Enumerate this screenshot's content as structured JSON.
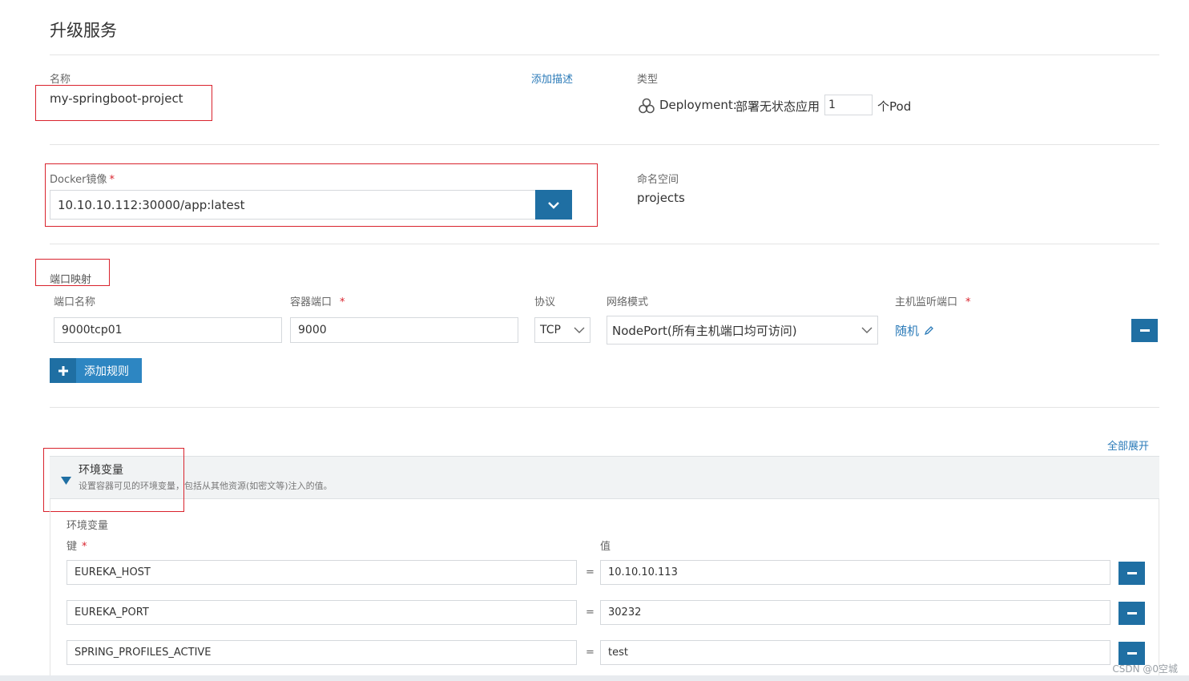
{
  "page": {
    "title": "升级服务"
  },
  "basic": {
    "name_label": "名称",
    "name_value": "my-springboot-project",
    "add_description": "添加描述",
    "type_label": "类型",
    "type_prefix": "Deployment:",
    "type_desc": "部署无状态应用",
    "pod_count": "1",
    "pod_suffix": "个Pod"
  },
  "image": {
    "label": "Docker镜像",
    "required": "*",
    "value": "10.10.10.112:30000/app:latest",
    "namespace_label": "命名空间",
    "namespace_value": "projects"
  },
  "ports": {
    "section_label": "端口映射",
    "headers": {
      "name": "端口名称",
      "container_port": "容器端口",
      "protocol": "协议",
      "network_mode": "网络模式",
      "host_port": "主机监听端口"
    },
    "required": "*",
    "row": {
      "name": "9000tcp01",
      "container_port": "9000",
      "protocol": "TCP",
      "network_mode": "NodePort(所有主机端口均可访问)",
      "host_port": "随机"
    },
    "add_rule": "添加规则"
  },
  "env": {
    "expand_all": "全部展开",
    "section_title": "环境变量",
    "section_desc": "设置容器可见的环境变量，包括从其他资源(如密文等)注入的值。",
    "sub_label": "环境变量",
    "key_label": "键",
    "value_label": "值",
    "required": "*",
    "eq": "=",
    "rows": [
      {
        "key": "EUREKA_HOST",
        "value": "10.10.10.113"
      },
      {
        "key": "EUREKA_PORT",
        "value": "30232"
      },
      {
        "key": "SPRING_PROFILES_ACTIVE",
        "value": "test"
      }
    ]
  },
  "watermark": "CSDN @0空城",
  "colors": {
    "primary": "#1f6fa3",
    "highlight": "#d9232d",
    "link": "#2a7ab8"
  }
}
